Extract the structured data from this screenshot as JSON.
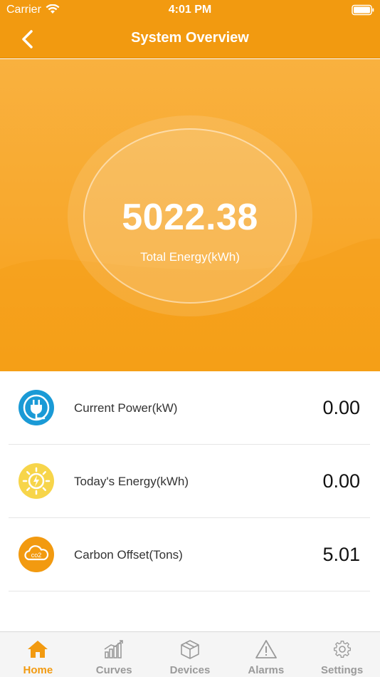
{
  "status_bar": {
    "carrier": "Carrier",
    "time": "4:01 PM"
  },
  "nav": {
    "title": "System Overview",
    "back_icon": "chevron-left-icon"
  },
  "hero": {
    "total_energy_value": "5022.38",
    "total_energy_label": "Total Energy(kWh)"
  },
  "stats": [
    {
      "icon": "plug-icon",
      "icon_color": "#1a9ad6",
      "label": "Current Power(kW)",
      "value": "0.00"
    },
    {
      "icon": "sun-bolt-icon",
      "icon_color": "#f7d54a",
      "label": "Today's Energy(kWh)",
      "value": "0.00"
    },
    {
      "icon": "co2-cloud-icon",
      "icon_color": "#f29a10",
      "label": "Carbon Offset(Tons)",
      "value": "5.01"
    }
  ],
  "tabs": [
    {
      "label": "Home",
      "icon": "home-icon",
      "active": true
    },
    {
      "label": "Curves",
      "icon": "chart-icon",
      "active": false
    },
    {
      "label": "Devices",
      "icon": "box-icon",
      "active": false
    },
    {
      "label": "Alarms",
      "icon": "warning-icon",
      "active": false
    },
    {
      "label": "Settings",
      "icon": "gear-icon",
      "active": false
    }
  ],
  "colors": {
    "accent": "#f29a10",
    "tab_inactive": "#9a9a9a"
  }
}
